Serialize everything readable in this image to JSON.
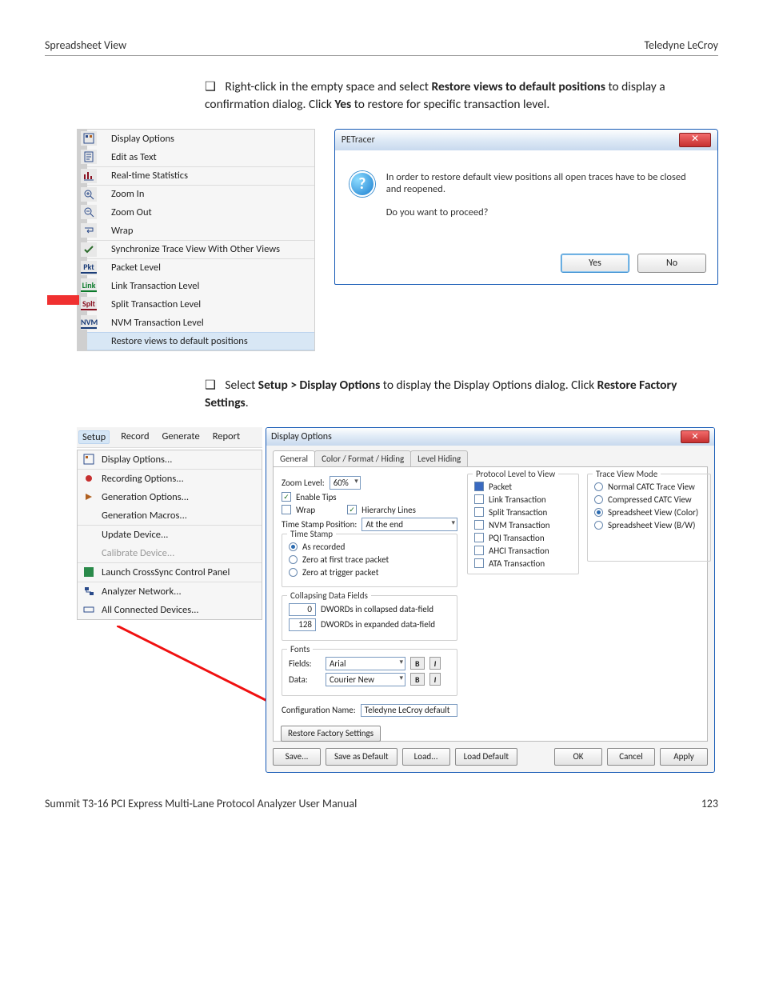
{
  "header": {
    "left": "Spreadsheet View",
    "right": "Teledyne LeCroy"
  },
  "para1": {
    "pre": "Right-click in the empty space and select ",
    "bold1": "Restore views to default positions",
    "mid": " to display a confirmation dialog. Click ",
    "bold2": "Yes",
    "post": " to restore for specific transaction level."
  },
  "ctx": {
    "items": [
      "Display Options",
      "Edit as Text",
      "Real-time Statistics",
      "Zoom In",
      "Zoom Out",
      "Wrap",
      "Synchronize Trace View With Other Views",
      "Packet Level",
      "Link Transaction Level",
      "Split Transaction Level",
      "NVM Transaction Level",
      "Restore views to default positions"
    ]
  },
  "dlg1": {
    "title": "PETracer",
    "msg1": "In order to restore default view positions all open traces have to be closed and reopened.",
    "msg2": "Do you want to proceed?",
    "yes": "Yes",
    "no": "No"
  },
  "para2": {
    "pre": "Select ",
    "bold1": "Setup > Display Options",
    "mid": " to display the Display Options dialog. Click ",
    "bold2": "Restore Factory Settings",
    "post": "."
  },
  "menubar": [
    "Setup",
    "Record",
    "Generate",
    "Report"
  ],
  "setupMenu": [
    "Display Options...",
    "Recording Options...",
    "Generation Options...",
    "Generation Macros...",
    "Update Device...",
    "Calibrate Device...",
    "Launch CrossSync Control Panel",
    "Analyzer Network...",
    "All Connected Devices..."
  ],
  "dlg2": {
    "title": "Display Options",
    "tabs": [
      "General",
      "Color / Format / Hiding",
      "Level Hiding"
    ],
    "zoomLabel": "Zoom Level:",
    "zoomVal": "60%",
    "enableTips": "Enable Tips",
    "wrap": "Wrap",
    "hierarchy": "Hierarchy Lines",
    "tsPosLabel": "Time Stamp Position:",
    "tsPosVal": "At the end",
    "tsGroup": "Time Stamp",
    "tsOpts": [
      "As recorded",
      "Zero at first trace packet",
      "Zero at trigger packet"
    ],
    "collGroup": "Collapsing Data Fields",
    "collA": "0",
    "collAlabel": "DWORDs in collapsed data-field",
    "collB": "128",
    "collBlabel": "DWORDs in expanded data-field",
    "fontsGroup": "Fonts",
    "fieldsLabel": "Fields:",
    "fieldsVal": "Arial",
    "dataLabel": "Data:",
    "dataVal": "Courier New",
    "cfgLabel": "Configuration Name:",
    "cfgVal": "Teledyne LeCroy default",
    "plGroup": "Protocol Level to View",
    "plItems": [
      "Packet",
      "Link Transaction",
      "Split Transaction",
      "NVM Transaction",
      "PQI Transaction",
      "AHCI Transaction",
      "ATA Transaction"
    ],
    "tvmGroup": "Trace View Mode",
    "tvmItems": [
      "Normal CATC Trace View",
      "Compressed CATC View",
      "Spreadsheet View (Color)",
      "Spreadsheet View (B/W)"
    ],
    "restore": "Restore Factory Settings",
    "save": "Save...",
    "saveDef": "Save as Default",
    "load": "Load...",
    "loadDef": "Load Default",
    "ok": "OK",
    "cancel": "Cancel",
    "apply": "Apply"
  },
  "footer": {
    "left": "Summit T3-16 PCI Express Multi-Lane Protocol Analyzer User Manual",
    "right": "123"
  }
}
